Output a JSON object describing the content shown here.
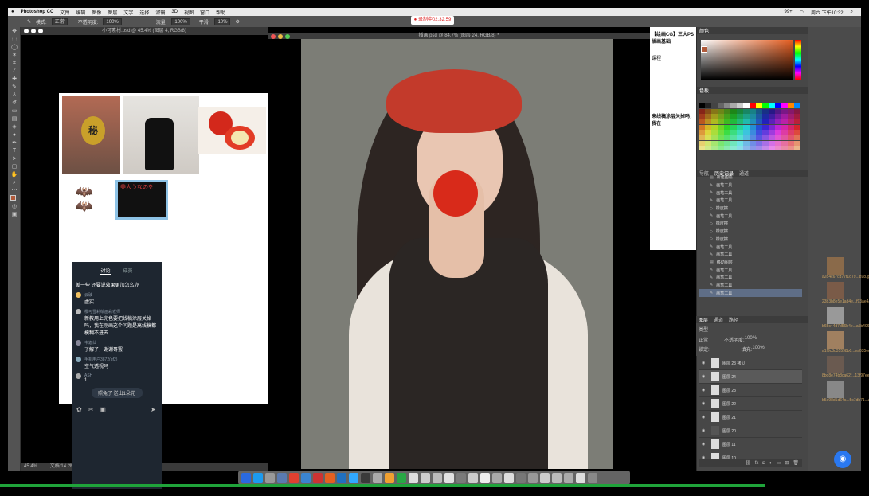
{
  "menubar": {
    "app": "Photoshop CC",
    "items": [
      "文件",
      "编辑",
      "图像",
      "图层",
      "文字",
      "选择",
      "滤镜",
      "3D",
      "视图",
      "窗口",
      "帮助"
    ],
    "right": [
      "99+",
      "周六 下午10:32"
    ]
  },
  "options": {
    "mode_label": "模式:",
    "mode_value": "正常",
    "opacity_label": "不透明度:",
    "opacity_value": "100%",
    "flow_label": "流量:",
    "flow_value": "100%",
    "smooth_label": "平滑:",
    "smooth_value": "10%"
  },
  "recording": "● 录制中02:32:59",
  "doc1": {
    "tab": "小可素材.psd @ 45.4% (图层 4, RGB/8)",
    "zoom": "45.4%",
    "status": "文档:14.2M"
  },
  "doc1_images": {
    "face_text": "秘",
    "text_image": "美人うなのを"
  },
  "chat": {
    "tabs": [
      "讨论",
      "成员"
    ],
    "messages": [
      {
        "name": "",
        "text": "差一些 还要说效果更加怎么办"
      },
      {
        "name": "云破",
        "text": "虚实"
      },
      {
        "name": "樱可雪莉绘画彩老师",
        "text": "新教用上完色要把线稿涂层关掉吗，我在刚画这个问题是高线稿都模糊不进去"
      },
      {
        "name": "韦迦仙",
        "text": "了解了，谢谢哥罢"
      },
      {
        "name": "手机用户3872(gf2)",
        "text": "空气透视吗"
      },
      {
        "name": "ASH",
        "text": "1"
      }
    ],
    "footer_pill": "照兔子 送出1朵花"
  },
  "doc2": {
    "tab": "插画.psd @ 84.7% (图层 24, RGB/8) *"
  },
  "browser": {
    "title": "【绘画CG】三大PS插画基础",
    "sub": "课程",
    "body": "来线稿涂层关掉吗，我在"
  },
  "color_panel": {
    "tab_color": "颜色",
    "tab_swatches": "色板"
  },
  "history": {
    "tabs": [
      "导航",
      "历史记录",
      "通道"
    ],
    "rows": [
      "新建图层",
      "画笔工具",
      "画笔工具",
      "画笔工具",
      "橡皮擦",
      "画笔工具",
      "橡皮擦",
      "橡皮擦",
      "橡皮擦",
      "画笔工具",
      "画笔工具",
      "移动图层",
      "画笔工具",
      "画笔工具",
      "画笔工具",
      "画笔工具"
    ]
  },
  "layers_panel": {
    "tabs": [
      "图层",
      "通道",
      "路径"
    ],
    "kind": "类型",
    "blend": "正常",
    "opacity_label": "不透明度:",
    "opacity": "100%",
    "lock_label": "锁定:",
    "fill_label": "填充:",
    "fill": "100%",
    "rows": [
      "图层 23 拷贝",
      "图层 24",
      "图层 23",
      "图层 22",
      "图层 21",
      "图层 20",
      "图层 11",
      "图层 10"
    ]
  },
  "files": [
    {
      "name": "a2d4c67cd77f1d79...898.jpeg"
    },
    {
      "name": "23b3b8e5e1ad4e...f93ae4a...jpeg"
    },
    {
      "name": "b65c44d7d56b4e...a5b496...9.jpeg"
    },
    {
      "name": "a1f9c8d35598b0...ea035ed...ef..jpeg"
    },
    {
      "name": "8bd8e74b8ca62f...13f97ee...ba.jpeg"
    },
    {
      "name": "b5e98d1d64c...5c7db71...a.jpeg"
    }
  ],
  "colors": {
    "accent": "#2a78f0",
    "selection": "#5f6e87",
    "record": "#dd2222",
    "green": "#1fa33a"
  }
}
